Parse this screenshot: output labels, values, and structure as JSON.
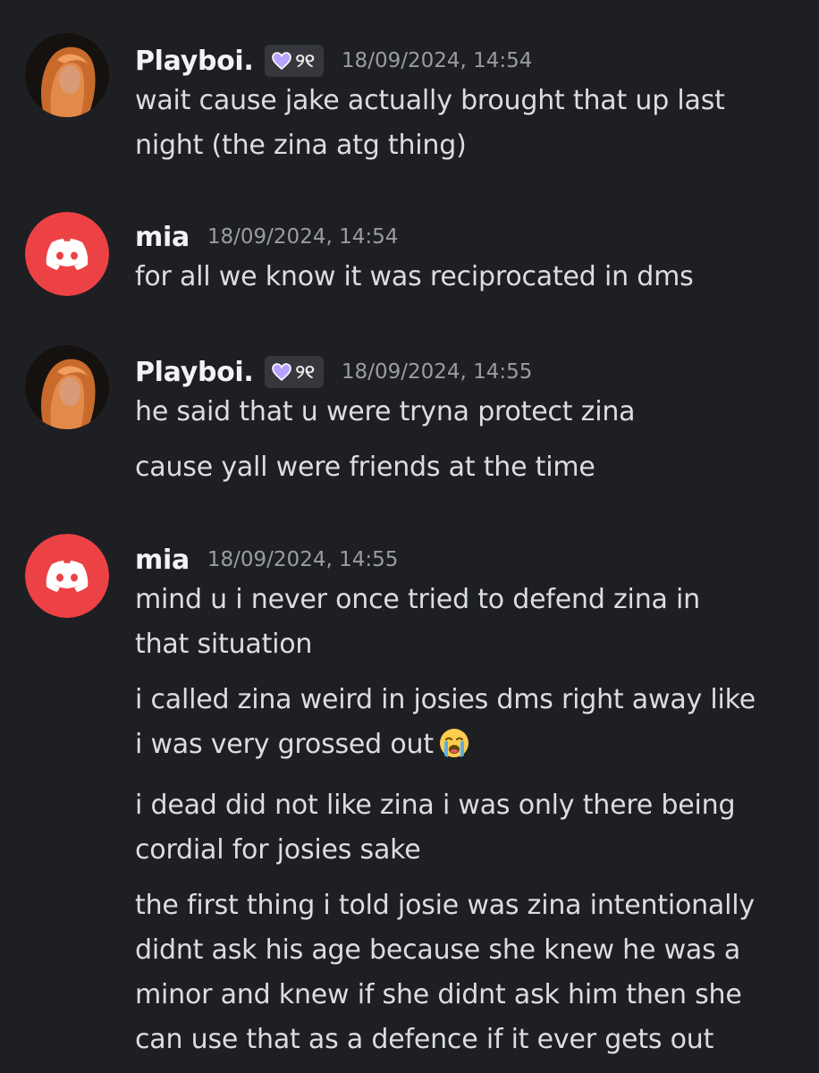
{
  "messages": [
    {
      "author": "Playboi.",
      "tag": "୨୧",
      "timestamp": "18/09/2024, 14:54",
      "lines": [
        "wait cause jake actually brought that up last",
        "night (the zina atg thing)"
      ]
    },
    {
      "author": "mia",
      "timestamp": "18/09/2024, 14:54",
      "lines": [
        "for all we know it was reciprocated in dms"
      ]
    },
    {
      "author": "Playboi.",
      "tag": "୨୧",
      "timestamp": "18/09/2024, 14:55",
      "lines": [
        "he said that u were tryna protect zina",
        "cause yall were friends at the time"
      ]
    },
    {
      "author": "mia",
      "timestamp": "18/09/2024, 14:55",
      "lines": [
        "mind u i never once tried to defend zina in",
        "that situation",
        "i called zina weird in josies dms right away like",
        "i was very grossed out",
        "i dead did not like zina i was only there being",
        "cordial for josies sake",
        "the first thing i told josie was zina intentionally",
        "didnt ask his age because she knew he was a",
        "minor and knew if she didnt ask him then she",
        "can use that as a defence if it ever gets out"
      ]
    }
  ],
  "icons": {
    "tag_icon": "purple-heart-icon",
    "default_avatar": "discord-logo-icon",
    "emoji": "loudly-crying-face-icon"
  },
  "colors": {
    "background": "#1e1f23",
    "discord_red": "#ed4245",
    "tag_heart": "#b9a2ff"
  }
}
